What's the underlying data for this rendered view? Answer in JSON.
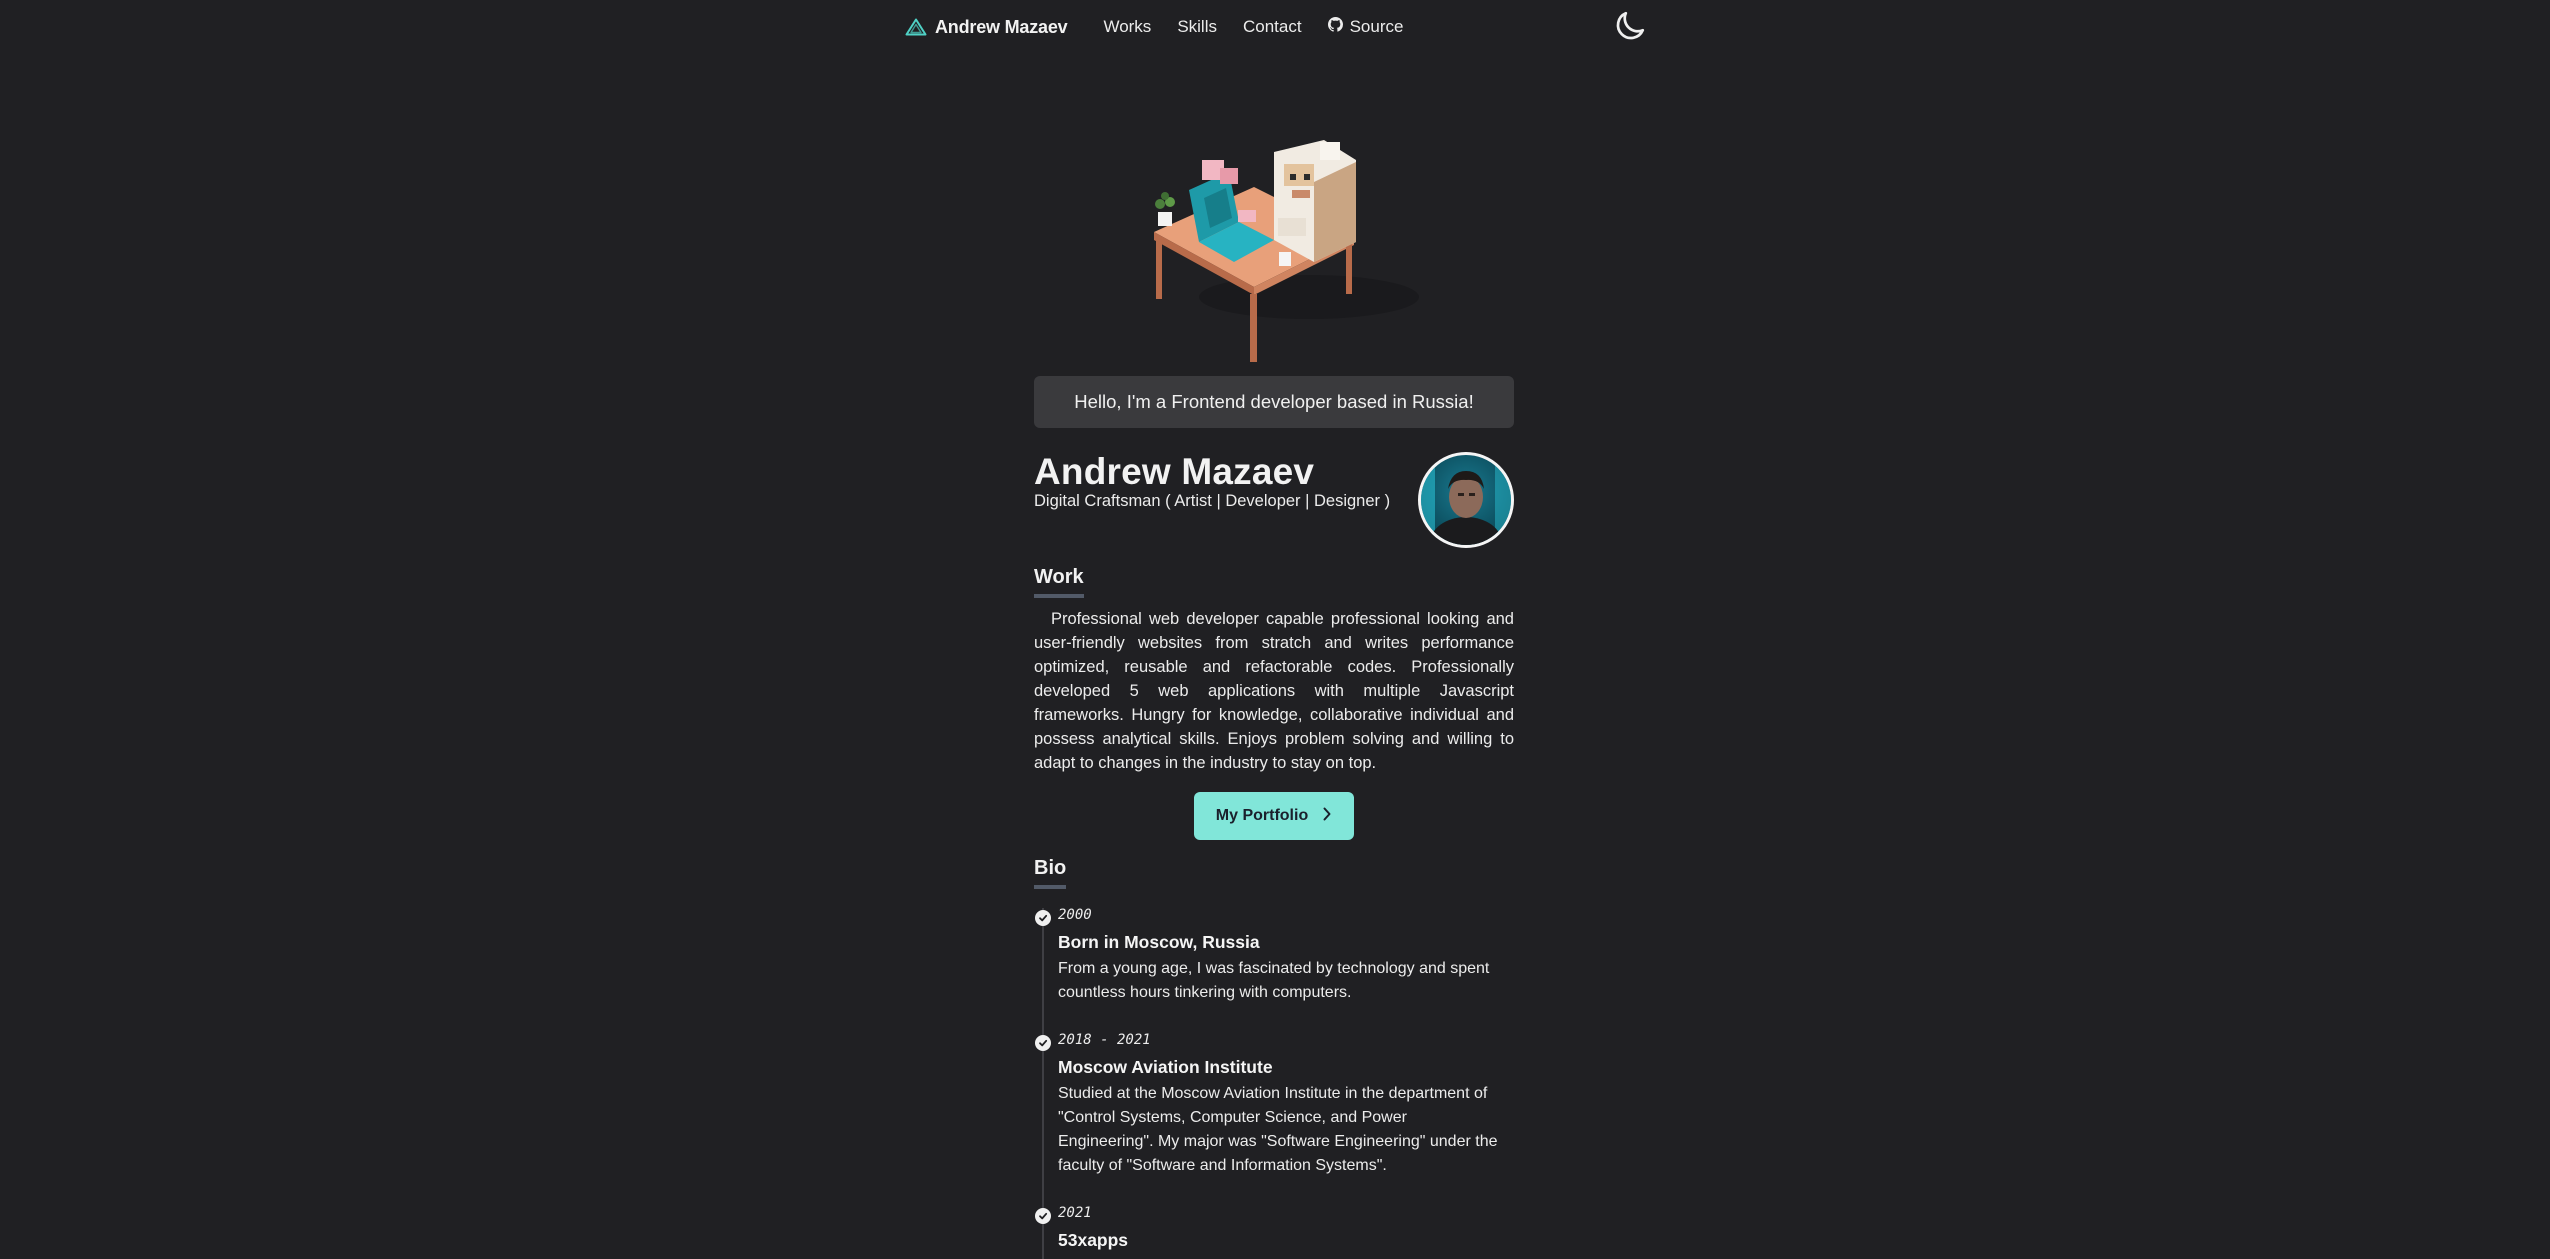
{
  "nav": {
    "brand": "Andrew Mazaev",
    "links": [
      "Works",
      "Skills",
      "Contact"
    ],
    "source_label": "Source",
    "icons": {
      "brand": "triangle-logo-icon",
      "source": "github-icon",
      "theme": "moon-icon"
    }
  },
  "hero": {
    "greeting": "Hello, I'm a Frontend developer based in Russia!"
  },
  "profile": {
    "name": "Andrew Mazaev",
    "role": "Digital Craftsman ( Artist | Developer | Designer )"
  },
  "work": {
    "title": "Work",
    "text": "Professional web developer capable professional looking and user-friendly websites from stratch and writes performance optimized, reusable and refactorable codes. Professionally developed 5 web applications with multiple Javascript frameworks. Hungry for knowledge, collaborative individual and possess analytical skills. Enjoys problem solving and willing to adapt to changes in the industry to stay on top.",
    "button_label": "My Portfolio"
  },
  "bio": {
    "title": "Bio",
    "items": [
      {
        "date": "2000",
        "heading": "Born in Moscow, Russia",
        "description": "From a young age, I was fascinated by technology and spent countless hours tinkering with computers."
      },
      {
        "date": "2018 - 2021",
        "heading": "Moscow Aviation Institute",
        "description": "Studied at the Moscow Aviation Institute in the department of \"Control Systems, Computer Science, and Power Engineering\". My major was \"Software Engineering\" under the faculty of \"Software and Information Systems\"."
      },
      {
        "date": "2021",
        "heading": "53xapps",
        "description": ""
      }
    ]
  },
  "colors": {
    "background": "#202023",
    "accent": "#81e6d9",
    "card": "#3a3a3d",
    "underline": "#525a68"
  }
}
